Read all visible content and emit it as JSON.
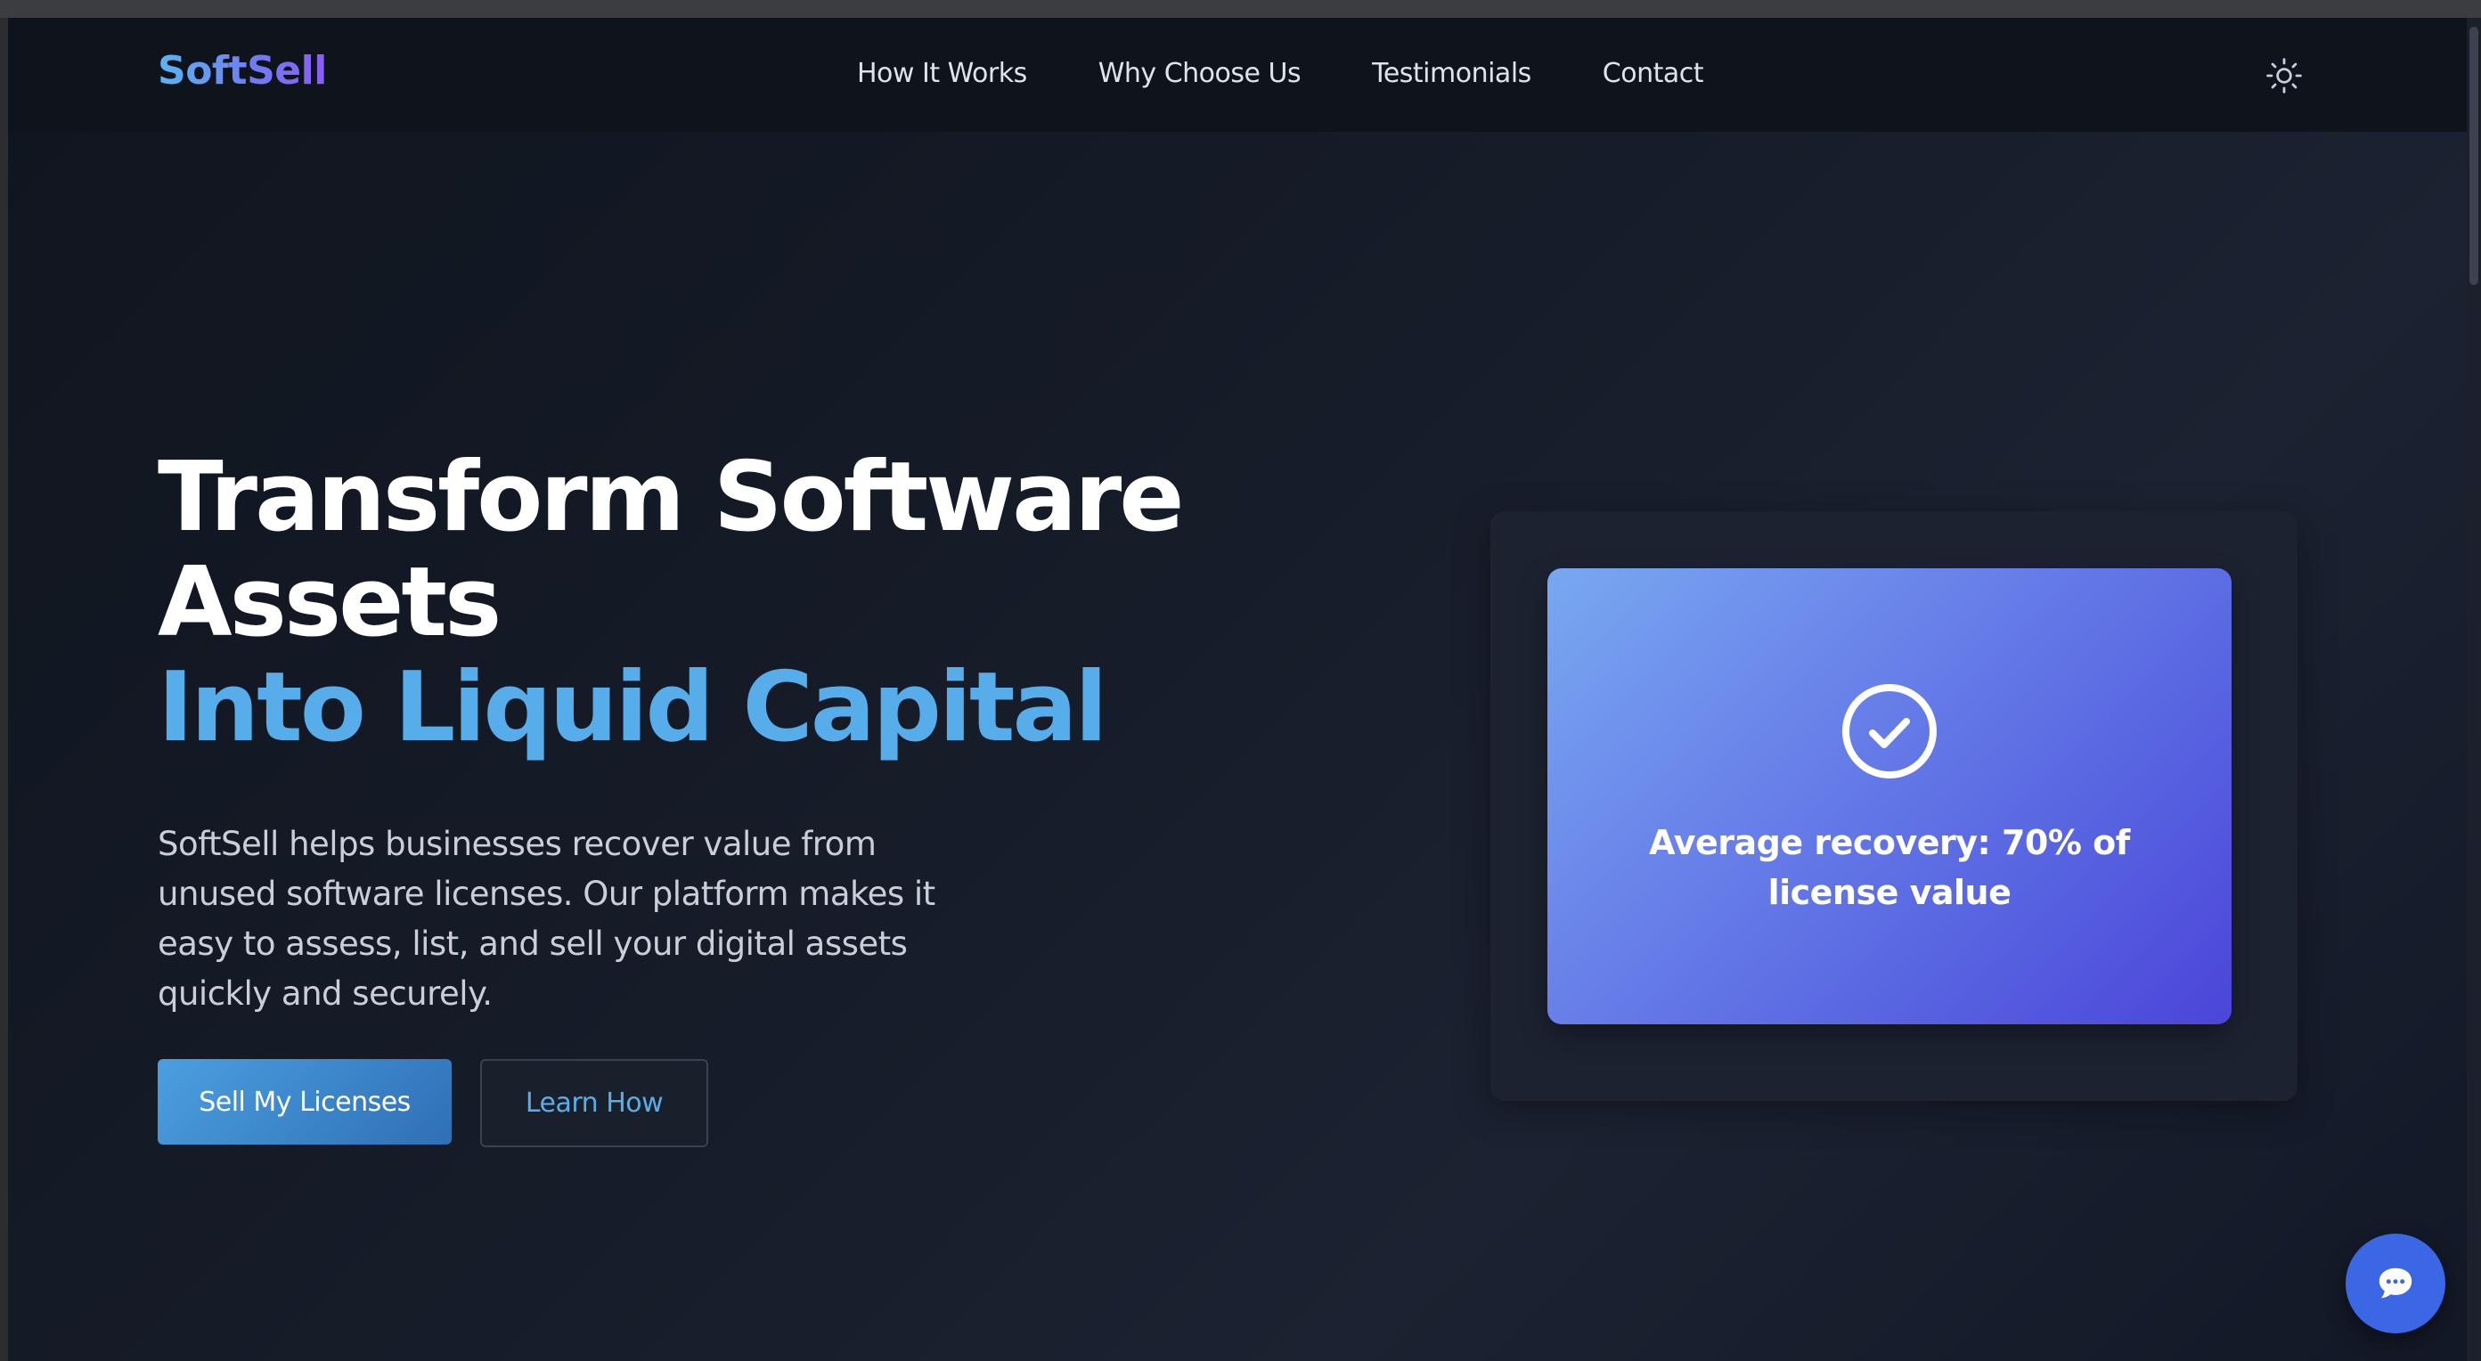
{
  "brand": {
    "name": "SoftSell"
  },
  "nav": {
    "items": [
      {
        "label": "How It Works"
      },
      {
        "label": "Why Choose Us"
      },
      {
        "label": "Testimonials"
      },
      {
        "label": "Contact"
      }
    ],
    "theme_toggle_icon": "sun-icon"
  },
  "hero": {
    "title_line1": "Transform Software",
    "title_line2": "Assets",
    "title_accent": "Into Liquid Capital",
    "description": "SoftSell helps businesses recover value from unused software licenses. Our platform makes it easy to assess, list, and sell your digital assets quickly and securely.",
    "primary_button": "Sell My Licenses",
    "secondary_button": "Learn How"
  },
  "stat_card": {
    "icon": "check-circle-icon",
    "text": "Average recovery: 70% of license value"
  },
  "chat": {
    "icon": "chat-bubble-icon"
  },
  "colors": {
    "accent": "#57acea",
    "card_gradient_start": "#78a8f0",
    "card_gradient_end": "#4b45d9",
    "chat_button": "#3b66e4"
  }
}
